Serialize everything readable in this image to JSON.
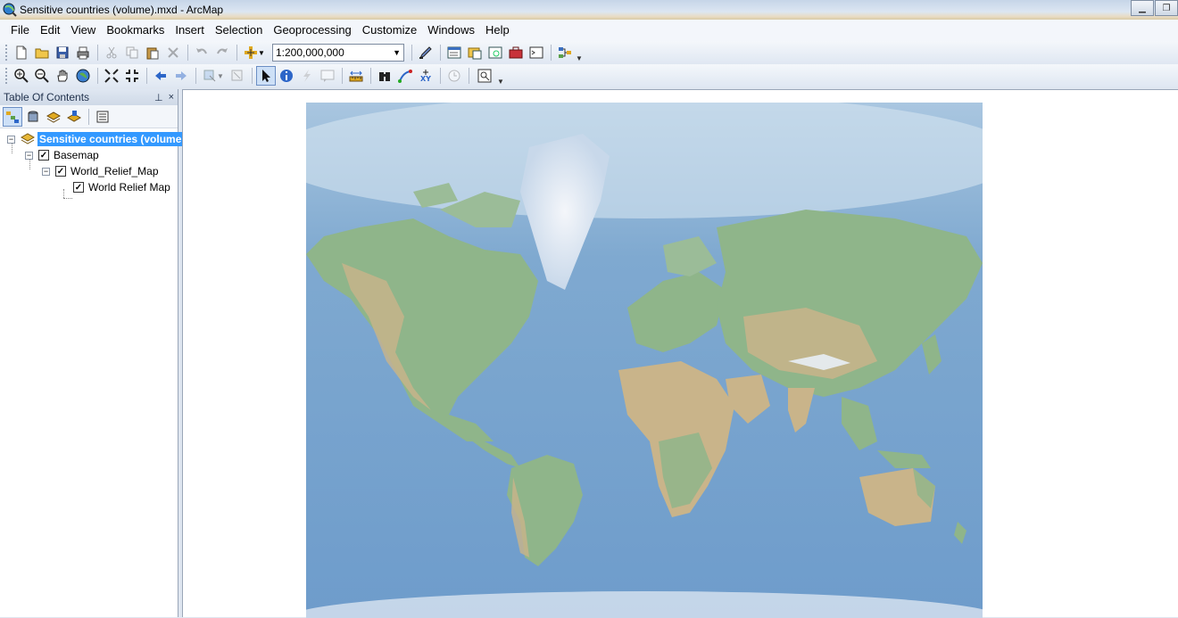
{
  "window": {
    "title": "Sensitive countries (volume).mxd - ArcMap"
  },
  "menu": [
    "File",
    "Edit",
    "View",
    "Bookmarks",
    "Insert",
    "Selection",
    "Geoprocessing",
    "Customize",
    "Windows",
    "Help"
  ],
  "toolbar": {
    "scale_value": "1:200,000,000"
  },
  "toc": {
    "title": "Table Of Contents",
    "dataframe": "Sensitive countries (volume",
    "layers": [
      {
        "label": "Basemap",
        "checked": true
      },
      {
        "label": "World_Relief_Map",
        "checked": true
      },
      {
        "label": "World Relief Map",
        "checked": true
      }
    ]
  },
  "colors": {
    "ocean": "#7aa6cc",
    "land_green": "#8fb58a",
    "land_tan": "#c9b48a",
    "ice": "#e8eef5",
    "selection": "#3399ff"
  }
}
